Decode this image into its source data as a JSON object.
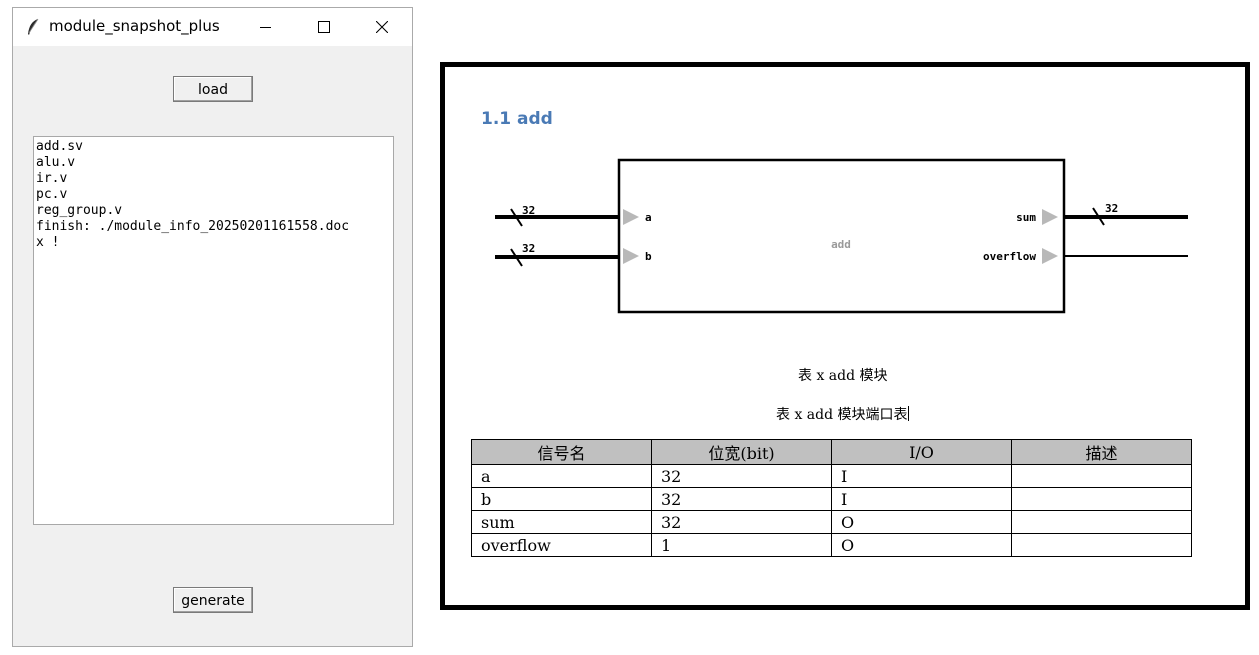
{
  "window": {
    "title": "module_snapshot_plus",
    "icons": [
      "feather-icon",
      "minimize-icon",
      "maximize-icon",
      "close-icon"
    ]
  },
  "controls": {
    "load_label": "load",
    "generate_label": "generate"
  },
  "log": {
    "lines": [
      "add.sv",
      "alu.v",
      "ir.v",
      "pc.v",
      "reg_group.v",
      "finish: ./module_info_20250201161558.doc",
      "x !"
    ]
  },
  "snapshot": {
    "heading": "1.1 add",
    "module_name": "add",
    "inputs": [
      {
        "name": "a",
        "width": "32"
      },
      {
        "name": "b",
        "width": "32"
      }
    ],
    "outputs": [
      {
        "name": "sum",
        "width": "32"
      },
      {
        "name": "overflow",
        "width": ""
      }
    ],
    "caption_module": "表 x add 模块",
    "caption_ports": "表 x add 模块端口表",
    "table": {
      "headers": [
        "信号名",
        "位宽(bit)",
        "I/O",
        "描述"
      ],
      "rows": [
        [
          "a",
          "32",
          "I",
          ""
        ],
        [
          "b",
          "32",
          "I",
          ""
        ],
        [
          "sum",
          "32",
          "O",
          ""
        ],
        [
          "overflow",
          "1",
          "O",
          ""
        ]
      ]
    }
  },
  "colors": {
    "heading": "#4a7ab5",
    "arrow": "#b8b8b8",
    "table_header_bg": "#c0c0c0"
  }
}
